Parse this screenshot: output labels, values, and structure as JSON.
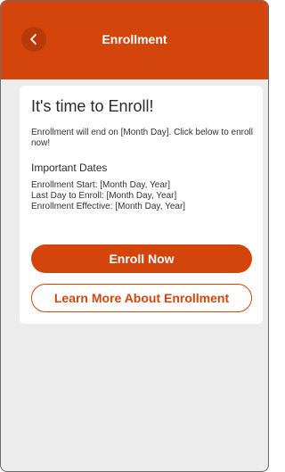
{
  "colors": {
    "accent": "#d3450b",
    "background": "#ececec",
    "card": "#ffffff"
  },
  "header": {
    "back_icon": "chevron-left-icon",
    "title": "Enrollment"
  },
  "card": {
    "title": "It's time to Enroll!",
    "description": "Enrollment will end on [Month Day]. Click below to enroll now!",
    "dates_heading": "Important Dates",
    "dates": [
      "Enrollment Start: [Month Day, Year]",
      "Last Day to Enroll: [Month Day, Year]",
      "Enrollment Effective: [Month Day, Year]"
    ],
    "enroll_label": "Enroll Now",
    "learn_more_label": "Learn More About Enrollment"
  }
}
